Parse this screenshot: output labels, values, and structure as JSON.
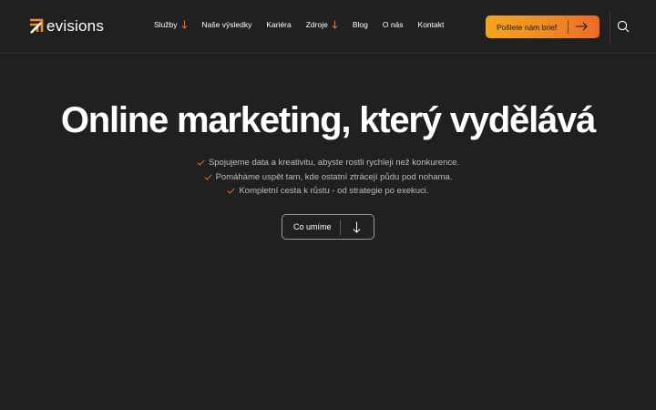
{
  "brand": {
    "name": "evisions",
    "accent_color": "#ef6a24"
  },
  "nav": {
    "items": [
      {
        "label": "Služby",
        "dropdown": true
      },
      {
        "label": "Naše výsledky",
        "dropdown": false
      },
      {
        "label": "Kariéra",
        "dropdown": false
      },
      {
        "label": "Zdroje",
        "dropdown": true
      },
      {
        "label": "Blog",
        "dropdown": false
      },
      {
        "label": "O nás",
        "dropdown": false
      },
      {
        "label": "Kontakt",
        "dropdown": false
      }
    ]
  },
  "header": {
    "cta_label": "Pošlete nám brief",
    "search_icon": "search-icon"
  },
  "hero": {
    "title": "Online marketing, který vydělává",
    "bullets": [
      "Spojujeme data a kreativitu, abyste rostli rychleji než konkurence.",
      "Pomáháme uspět tam, kde ostatní ztrácejí půdu pod nohama.",
      "Kompletní cesta k růstu - od strategie po exekuci."
    ],
    "button_label": "Co umíme"
  },
  "colors": {
    "background": "#202020",
    "cta_gradient_start": "#f6a41c",
    "cta_gradient_end": "#ea6b2a",
    "check_color": "#ef6a24"
  }
}
